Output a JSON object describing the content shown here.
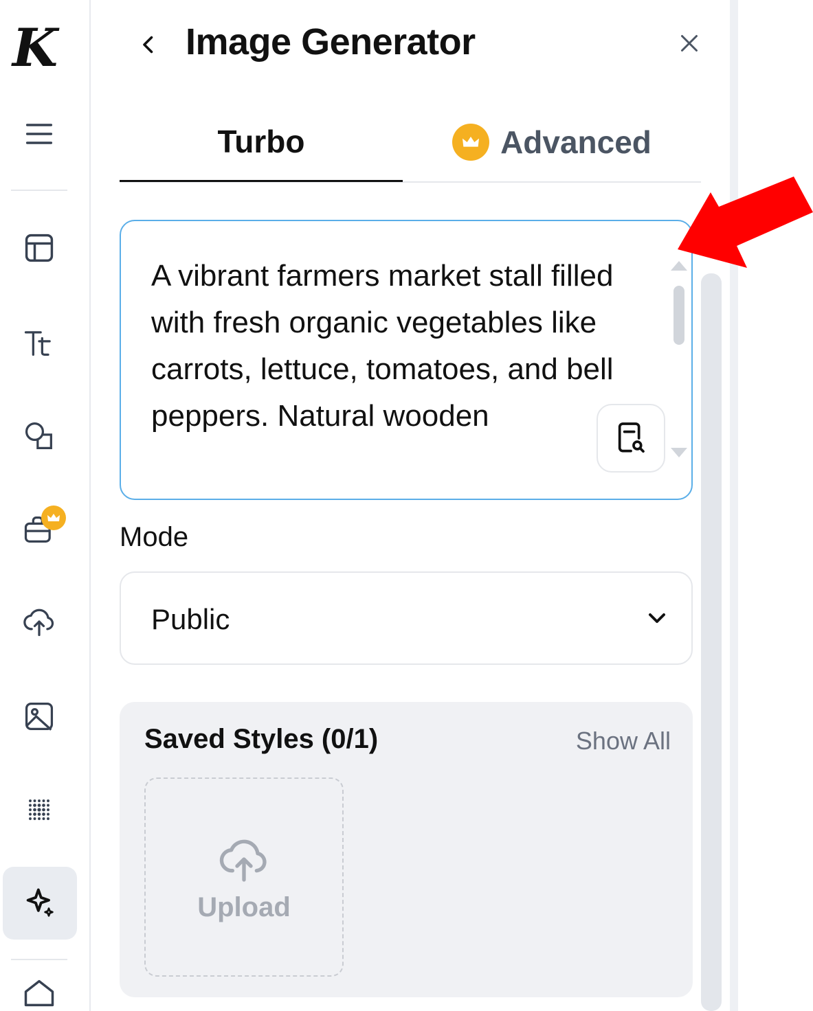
{
  "rail": {
    "logo": "K",
    "items": [
      {
        "icon": "menu-icon"
      },
      {
        "icon": "layout-icon"
      },
      {
        "icon": "text-icon"
      },
      {
        "icon": "shapes-icon"
      },
      {
        "icon": "toolbox-icon",
        "premium": true
      },
      {
        "icon": "upload-cloud-icon"
      },
      {
        "icon": "image-icon"
      },
      {
        "icon": "dots-grid-icon"
      },
      {
        "icon": "sparkle-icon",
        "active": true
      },
      {
        "icon": "home-icon"
      }
    ]
  },
  "header": {
    "title": "Image Generator"
  },
  "tabs": {
    "turbo": "Turbo",
    "advanced": "Advanced"
  },
  "prompt": {
    "value": "A vibrant farmers market stall filled with fresh organic vegetables like carrots, lettuce, tomatoes, and bell peppers. Natural wooden"
  },
  "mode": {
    "label": "Mode",
    "selected": "Public"
  },
  "saved_styles": {
    "title": "Saved Styles (0/1)",
    "show_all": "Show All",
    "upload_label": "Upload"
  },
  "colors": {
    "accent_border": "#5aaee8",
    "premium_gold": "#f5b021",
    "annotation_arrow": "#ff0000"
  }
}
